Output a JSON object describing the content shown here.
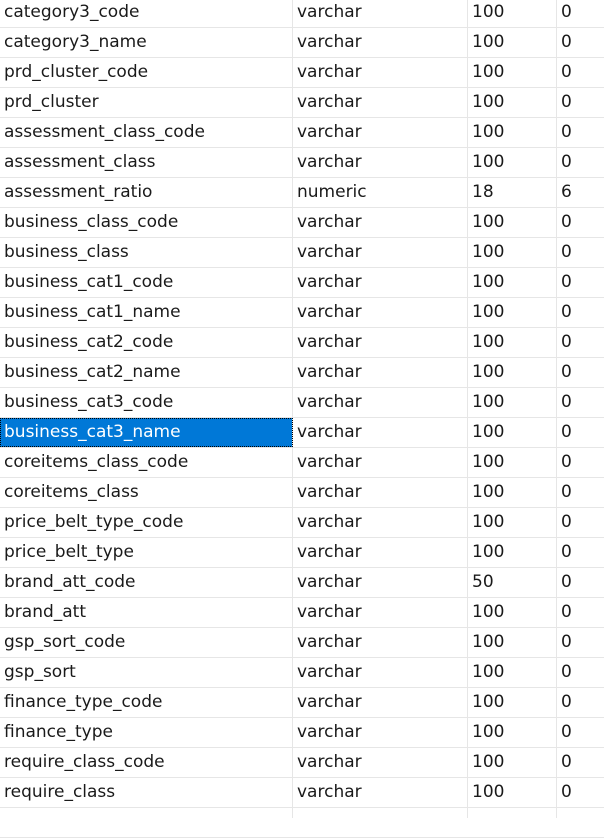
{
  "table": {
    "columns": [
      "name",
      "type",
      "length",
      "decimals"
    ],
    "selected_row_index": 14,
    "selected_column": "name",
    "selection_color": "#0078d7",
    "rows": [
      {
        "name": "category3_code",
        "type": "varchar",
        "length": "100",
        "decimals": "0"
      },
      {
        "name": "category3_name",
        "type": "varchar",
        "length": "100",
        "decimals": "0"
      },
      {
        "name": "prd_cluster_code",
        "type": "varchar",
        "length": "100",
        "decimals": "0"
      },
      {
        "name": "prd_cluster",
        "type": "varchar",
        "length": "100",
        "decimals": "0"
      },
      {
        "name": "assessment_class_code",
        "type": "varchar",
        "length": "100",
        "decimals": "0"
      },
      {
        "name": "assessment_class",
        "type": "varchar",
        "length": "100",
        "decimals": "0"
      },
      {
        "name": "assessment_ratio",
        "type": "numeric",
        "length": "18",
        "decimals": "6"
      },
      {
        "name": "business_class_code",
        "type": "varchar",
        "length": "100",
        "decimals": "0"
      },
      {
        "name": "business_class",
        "type": "varchar",
        "length": "100",
        "decimals": "0"
      },
      {
        "name": "business_cat1_code",
        "type": "varchar",
        "length": "100",
        "decimals": "0"
      },
      {
        "name": "business_cat1_name",
        "type": "varchar",
        "length": "100",
        "decimals": "0"
      },
      {
        "name": "business_cat2_code",
        "type": "varchar",
        "length": "100",
        "decimals": "0"
      },
      {
        "name": "business_cat2_name",
        "type": "varchar",
        "length": "100",
        "decimals": "0"
      },
      {
        "name": "business_cat3_code",
        "type": "varchar",
        "length": "100",
        "decimals": "0"
      },
      {
        "name": "business_cat3_name",
        "type": "varchar",
        "length": "100",
        "decimals": "0"
      },
      {
        "name": "coreitems_class_code",
        "type": "varchar",
        "length": "100",
        "decimals": "0"
      },
      {
        "name": "coreitems_class",
        "type": "varchar",
        "length": "100",
        "decimals": "0"
      },
      {
        "name": "price_belt_type_code",
        "type": "varchar",
        "length": "100",
        "decimals": "0"
      },
      {
        "name": "price_belt_type",
        "type": "varchar",
        "length": "100",
        "decimals": "0"
      },
      {
        "name": "brand_att_code",
        "type": "varchar",
        "length": "50",
        "decimals": "0"
      },
      {
        "name": "brand_att",
        "type": "varchar",
        "length": "100",
        "decimals": "0"
      },
      {
        "name": "gsp_sort_code",
        "type": "varchar",
        "length": "100",
        "decimals": "0"
      },
      {
        "name": "gsp_sort",
        "type": "varchar",
        "length": "100",
        "decimals": "0"
      },
      {
        "name": "finance_type_code",
        "type": "varchar",
        "length": "100",
        "decimals": "0"
      },
      {
        "name": "finance_type",
        "type": "varchar",
        "length": "100",
        "decimals": "0"
      },
      {
        "name": "require_class_code",
        "type": "varchar",
        "length": "100",
        "decimals": "0"
      },
      {
        "name": "require_class",
        "type": "varchar",
        "length": "100",
        "decimals": "0"
      }
    ]
  }
}
